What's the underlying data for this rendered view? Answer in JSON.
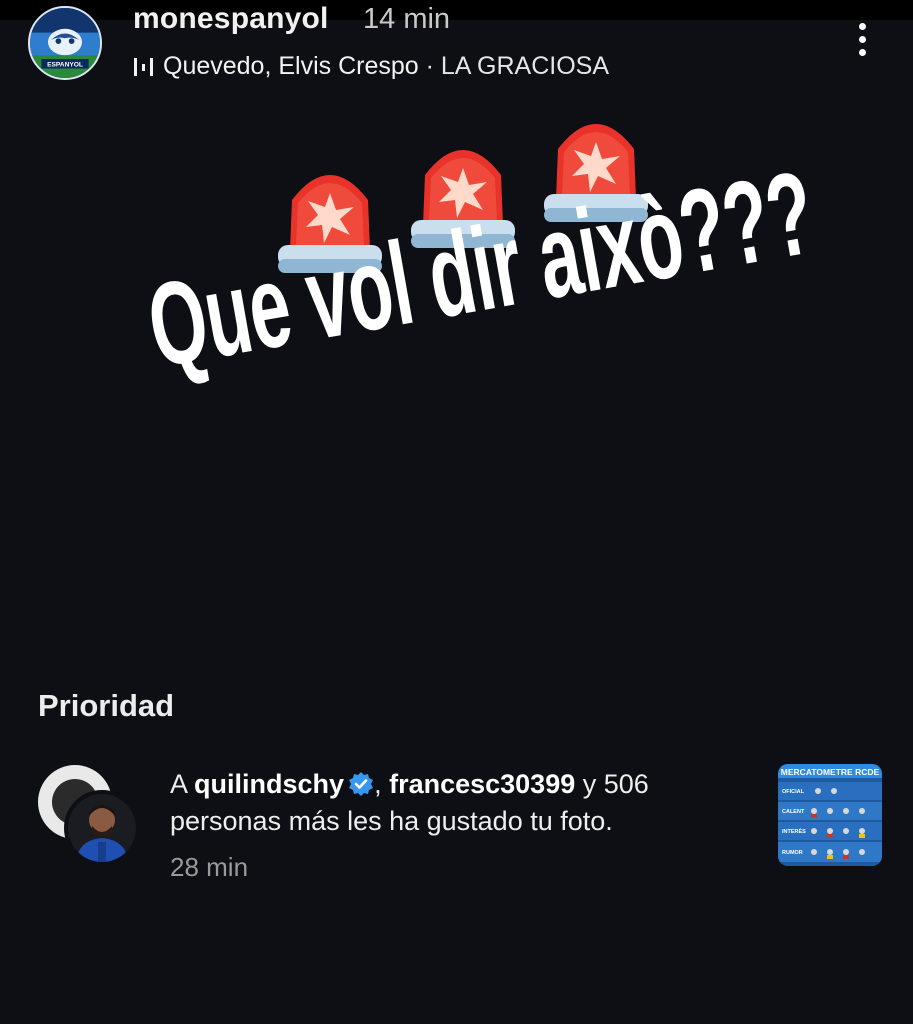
{
  "story": {
    "username": "monespanyol",
    "time_ago": "14 min",
    "music": {
      "artists": "Quevedo, Elvis Crespo",
      "separator": " · ",
      "song": "LA GRACIOSA"
    },
    "text": "Que vol dir això???",
    "avatar_label": "ESPANYOL"
  },
  "notifications": {
    "section_title": "Prioridad",
    "item": {
      "prefix": "A ",
      "user1": "quilindschy",
      "separator": ", ",
      "user2": "francesc30399",
      "rest_line1": " y 506",
      "rest_line2": "personas más les ha gustado tu foto.",
      "time": "28 min",
      "thumbnail": {
        "title": "MERCATOMETRE RCDE",
        "rows": [
          "OFICIAL",
          "CALENT",
          "INTERÈS",
          "RUMOR"
        ]
      }
    }
  },
  "colors": {
    "background": "#0d0f14",
    "verified": "#3897f0",
    "siren_red": "#e8322a"
  },
  "icons": [
    "more-options-icon",
    "music-bars-icon",
    "siren-emoji-icon",
    "verified-badge-icon"
  ]
}
